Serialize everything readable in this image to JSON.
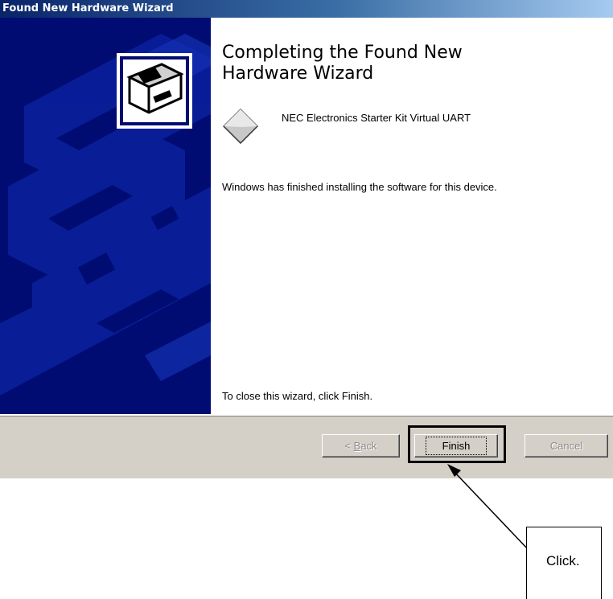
{
  "window": {
    "title": "Found New Hardware Wizard"
  },
  "content": {
    "heading_line1": "Completing the Found New",
    "heading_line2": "Hardware Wizard",
    "device_icon": "device-diamond-icon",
    "device_name": "NEC Electronics Starter Kit Virtual UART",
    "message": "Windows has finished installing the software for this device.",
    "close_message": "To close this wizard, click Finish."
  },
  "buttons": {
    "back_prefix": "< ",
    "back_mnemonic": "B",
    "back_rest": "ack",
    "finish": "Finish",
    "cancel": "Cancel"
  },
  "annotation": {
    "text": "Click."
  },
  "colors": {
    "side_panel": "#000c72",
    "title_gradient_start": "#0a246a",
    "title_gradient_end": "#a6caf0",
    "button_face": "#d4d0c8"
  }
}
